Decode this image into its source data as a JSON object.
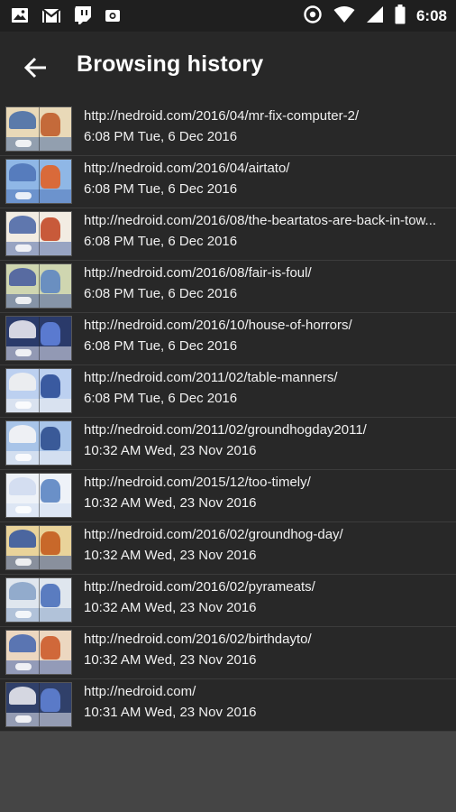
{
  "status_bar": {
    "time": "6:08",
    "left_icons": [
      "image-icon",
      "gmail-icon",
      "twitch-icon",
      "camera-icon"
    ],
    "right_icons": [
      "data-saver-icon",
      "wifi-icon",
      "signal-icon",
      "battery-icon"
    ]
  },
  "app_bar": {
    "title": "Browsing history",
    "back_icon": "arrow-back-icon"
  },
  "history": [
    {
      "url": "http://nedroid.com/2016/04/mr-fix-computer-2/",
      "time": "6:08 PM Tue, 6 Dec 2016",
      "thumb": [
        "#e9d9b8",
        "#c46a3a",
        "#4a6fa8"
      ]
    },
    {
      "url": "http://nedroid.com/2016/04/airtato/",
      "time": "6:08 PM Tue, 6 Dec 2016",
      "thumb": [
        "#8fb7e6",
        "#d96a3a",
        "#5076b8"
      ]
    },
    {
      "url": "http://nedroid.com/2016/08/the-beartatos-are-back-in-tow...",
      "time": "6:08 PM Tue, 6 Dec 2016",
      "thumb": [
        "#f2ece2",
        "#c85a3a",
        "#4f6aa8"
      ]
    },
    {
      "url": "http://nedroid.com/2016/08/fair-is-foul/",
      "time": "6:08 PM Tue, 6 Dec 2016",
      "thumb": [
        "#cfd6b0",
        "#6a8fc0",
        "#4a5fa0"
      ]
    },
    {
      "url": "http://nedroid.com/2016/10/house-of-horrors/",
      "time": "6:08 PM Tue, 6 Dec 2016",
      "thumb": [
        "#2a3a6a",
        "#5a7ad0",
        "#e8e8f0"
      ]
    },
    {
      "url": "http://nedroid.com/2011/02/table-manners/",
      "time": "6:08 PM Tue, 6 Dec 2016",
      "thumb": [
        "#bcd0f0",
        "#3a5aa0",
        "#f0f0f0"
      ]
    },
    {
      "url": "http://nedroid.com/2011/02/groundhogday2011/",
      "time": "10:32 AM Wed, 23 Nov 2016",
      "thumb": [
        "#a8c4e8",
        "#3a5a98",
        "#f5f5f5"
      ]
    },
    {
      "url": "http://nedroid.com/2015/12/too-timely/",
      "time": "10:32 AM Wed, 23 Nov 2016",
      "thumb": [
        "#eef2f8",
        "#6a90c8",
        "#d0dcf0"
      ]
    },
    {
      "url": "http://nedroid.com/2016/02/groundhog-day/",
      "time": "10:32 AM Wed, 23 Nov 2016",
      "thumb": [
        "#e9d39a",
        "#c8682a",
        "#3a5aa0"
      ]
    },
    {
      "url": "http://nedroid.com/2016/02/pyrameats/",
      "time": "10:32 AM Wed, 23 Nov 2016",
      "thumb": [
        "#dfe6ee",
        "#5a7cc0",
        "#8aa4c8"
      ]
    },
    {
      "url": "http://nedroid.com/2016/02/birthdayto/",
      "time": "10:32 AM Wed, 23 Nov 2016",
      "thumb": [
        "#ecd7c0",
        "#d0683a",
        "#4a6ab0"
      ]
    },
    {
      "url": "http://nedroid.com/",
      "time": "10:31 AM Wed, 23 Nov 2016",
      "thumb": [
        "#30406a",
        "#5a7ac8",
        "#e8e8ee"
      ]
    }
  ]
}
